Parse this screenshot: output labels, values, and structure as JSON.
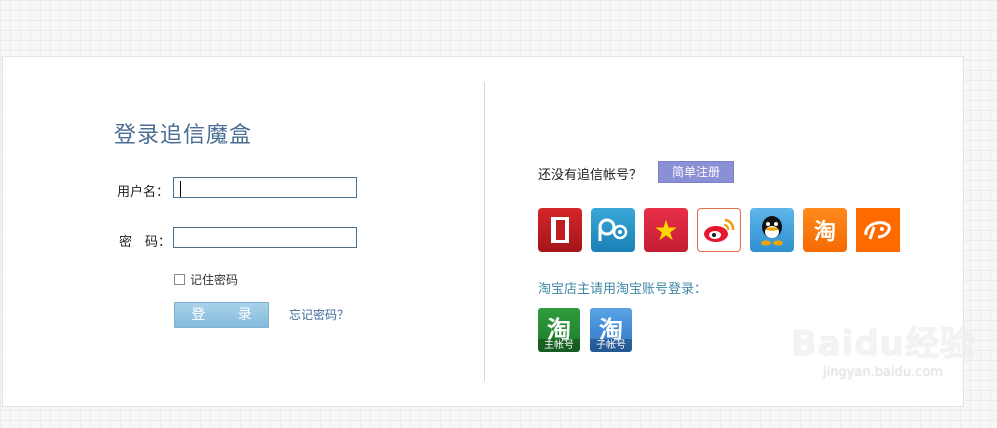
{
  "login": {
    "title": "登录追信魔盒",
    "username_label": "用户名：",
    "username_value": "",
    "password_label": "密　码：",
    "password_value": "",
    "remember_label": "记住密码",
    "remember_checked": false,
    "login_button": "登 录",
    "forgot_link": "忘记密码？"
  },
  "register": {
    "prompt": "还没有追信帐号？",
    "button": "简单注册"
  },
  "social_icons": [
    "netease-icon",
    "pp-icon",
    "star-icon",
    "weibo-icon",
    "qq-icon",
    "taobao-icon",
    "alibaba-icon"
  ],
  "taobao": {
    "label": "淘宝店主请用淘宝账号登录：",
    "main_account": "主帐号",
    "sub_account": "子帐号",
    "glyph": "淘"
  },
  "watermark": {
    "main": "Baidu经验",
    "sub": "jingyan.baidu.com"
  }
}
